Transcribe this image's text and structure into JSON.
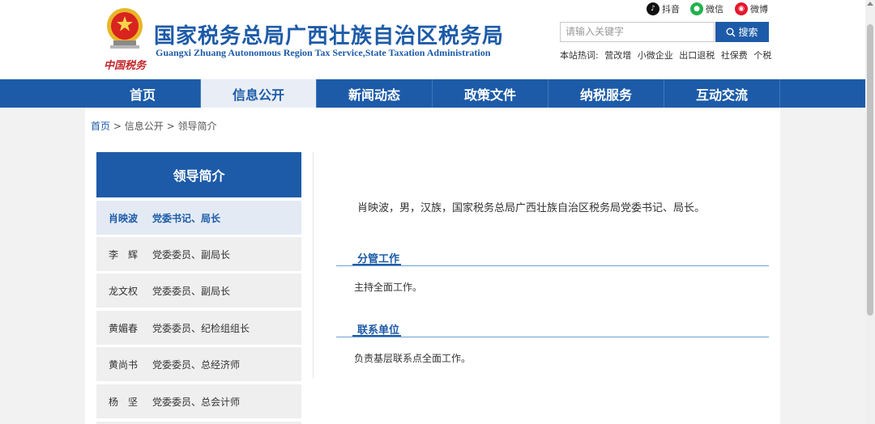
{
  "header": {
    "title": "国家税务总局广西壮族自治区税务局",
    "subtitle": "Guangxi Zhuang Autonomous Region Tax Service,State Taxation Administration",
    "logo_text": "中国税务",
    "social": [
      {
        "label": "抖音",
        "icon": "douyin-icon",
        "color": "#111111"
      },
      {
        "label": "微信",
        "icon": "wechat-icon",
        "color": "#22b14c"
      },
      {
        "label": "微博",
        "icon": "weibo-icon",
        "color": "#e6162d"
      }
    ],
    "search": {
      "placeholder": "请输入关键字",
      "button_label": "搜索"
    },
    "hotwords_label": "本站热词:",
    "hotwords": [
      "营改增",
      "小微企业",
      "出口退税",
      "社保费",
      "个税"
    ]
  },
  "nav": {
    "items": [
      "首页",
      "信息公开",
      "新闻动态",
      "政策文件",
      "纳税服务",
      "互动交流"
    ],
    "active_index": 1
  },
  "breadcrumb": {
    "home": "首页",
    "sep": ">",
    "level1": "信息公开",
    "level2": "领导简介"
  },
  "sidebar": {
    "title": "领导简介",
    "items": [
      {
        "name": "肖映波",
        "title": "党委书记、局长"
      },
      {
        "name": "李　辉",
        "title": "党委委员、副局长"
      },
      {
        "name": "龙文权",
        "title": "党委委员、副局长"
      },
      {
        "name": "黄媚春",
        "title": "党委委员、纪检组组长"
      },
      {
        "name": "黄尚书",
        "title": "党委委员、总经济师"
      },
      {
        "name": "杨　坚",
        "title": "党委委员、总会计师"
      }
    ],
    "active_index": 0
  },
  "content": {
    "intro": "肖映波，男，汉族，国家税务总局广西壮族自治区税务局党委书记、局长。",
    "sections": [
      {
        "title": "分管工作",
        "text": "主持全面工作。"
      },
      {
        "title": "联系单位",
        "text": "负责基层联系点全面工作。"
      }
    ]
  },
  "colors": {
    "brand": "#1d5ba8",
    "nav_active_bg": "#e9eef6"
  }
}
